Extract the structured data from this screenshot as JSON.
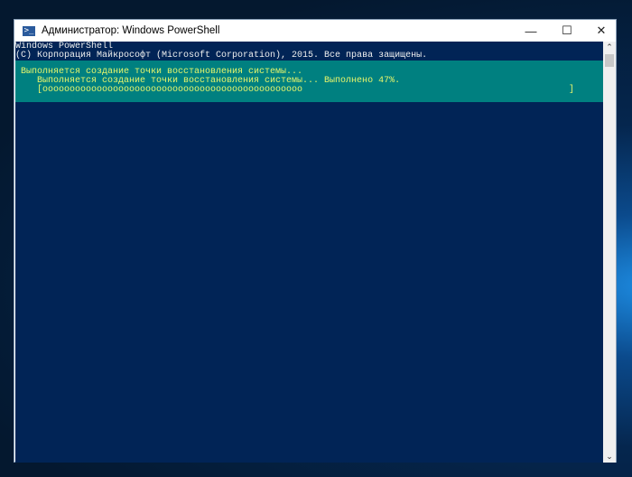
{
  "window": {
    "title": "Администратор: Windows PowerShell",
    "icon": "powershell-icon",
    "controls": {
      "minimize": "—",
      "maximize": "☐",
      "close": "✕"
    }
  },
  "console": {
    "lines": [
      "Windows PowerShell",
      "(C) Корпорация Майкрософт (Microsoft Corporation), 2015. Все права защищены."
    ],
    "progress": {
      "activity": "Выполняется создание точки восстановления системы...",
      "status": "   Выполняется создание точки восстановления системы... Выполнено 47%.",
      "bar": "   [oooooooooooooooooooooooooooooooooooooooooooooooo",
      "bar_end": "]",
      "percent": 47
    }
  },
  "colors": {
    "console_bg": "#012456",
    "progress_bg": "#008080",
    "progress_text": "#e5f56b"
  }
}
